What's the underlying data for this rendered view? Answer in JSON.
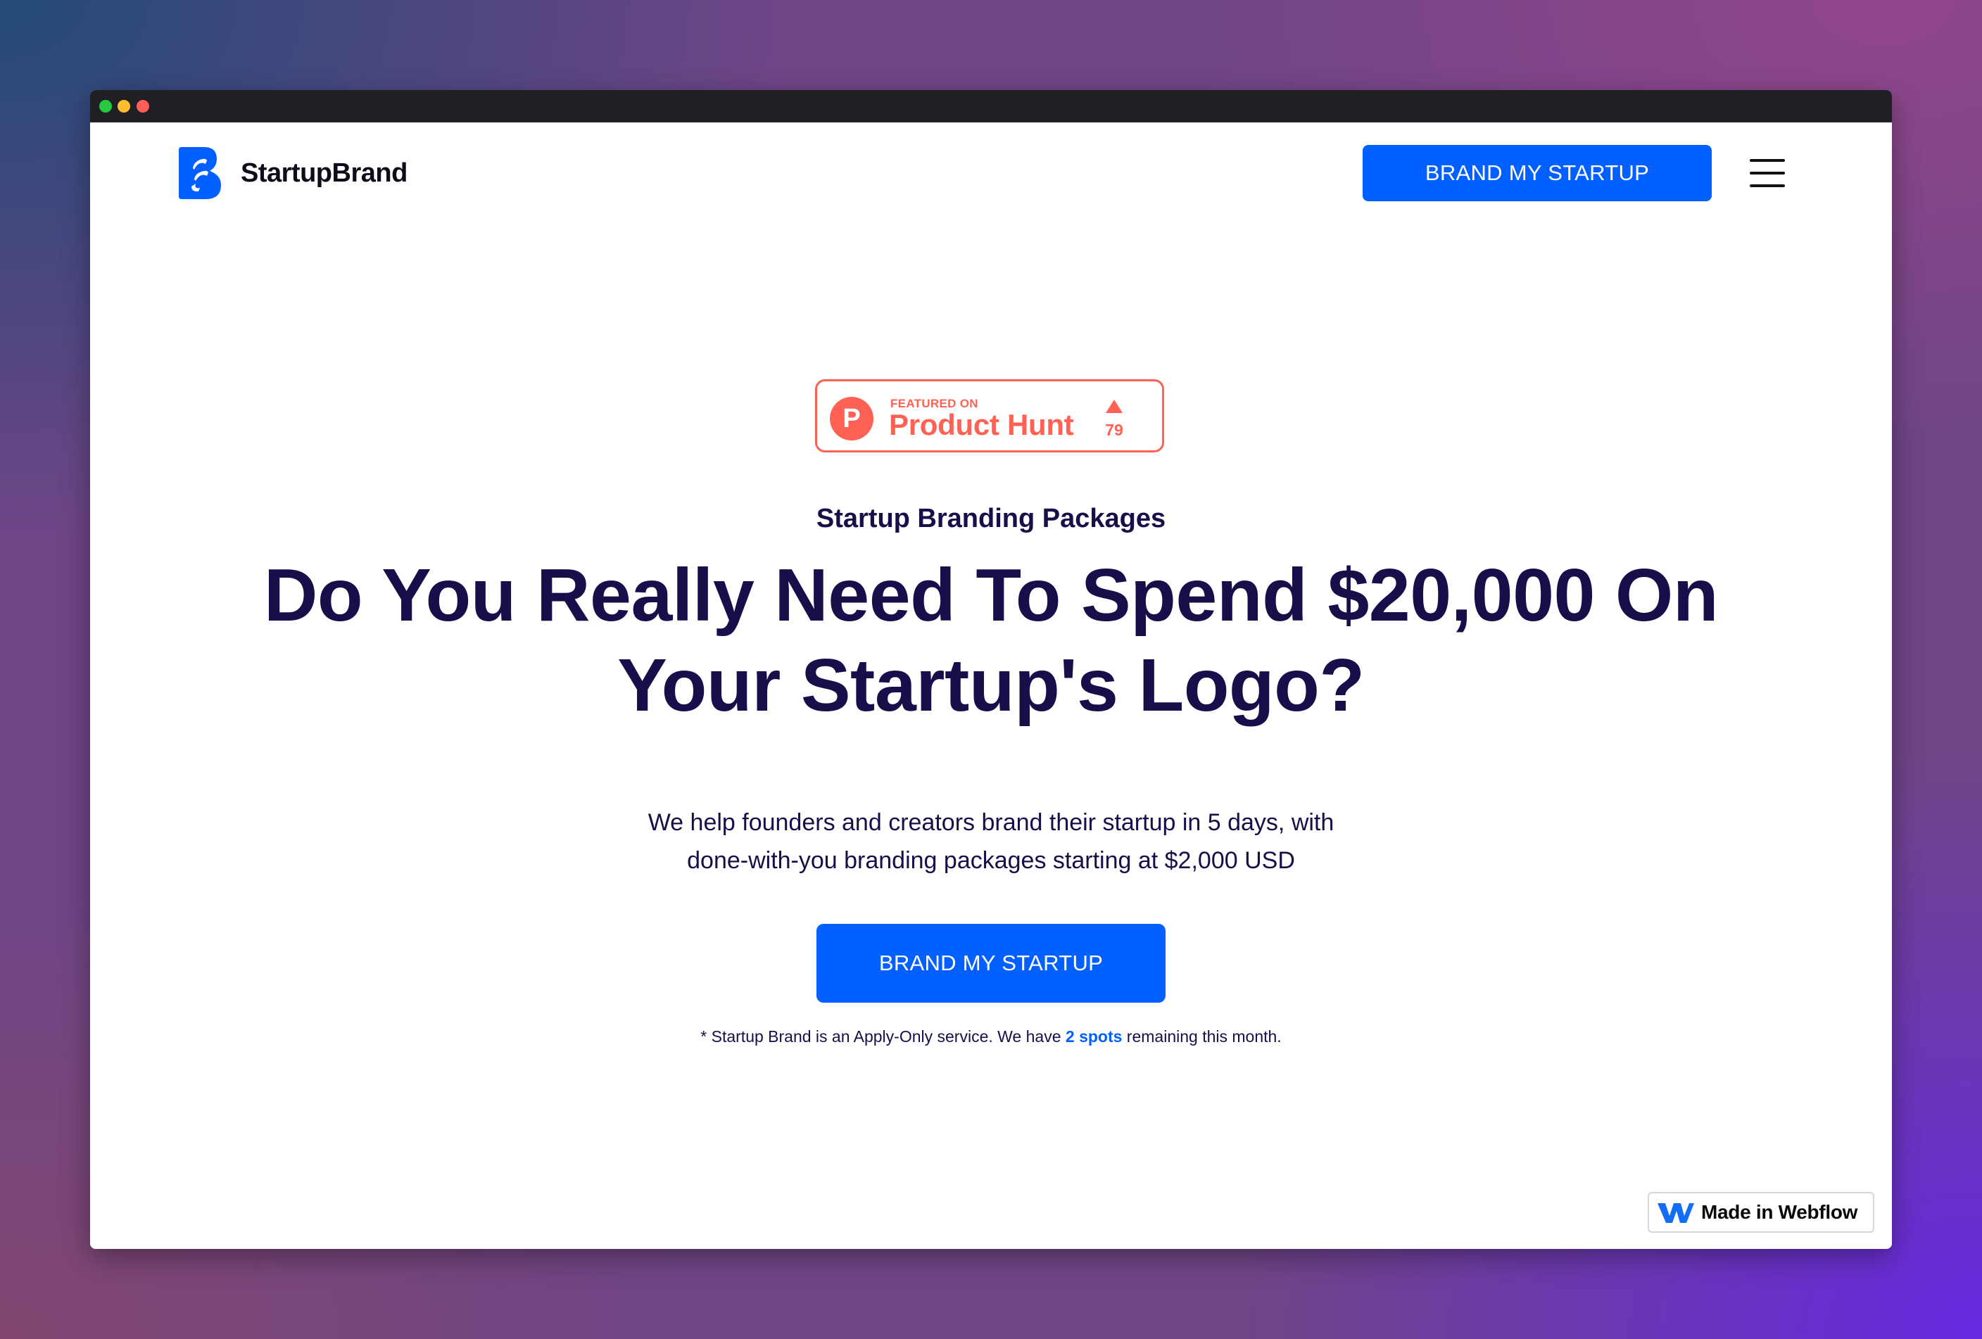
{
  "colors": {
    "primary_blue": "#0160ff",
    "heading_navy": "#170f4a",
    "product_hunt_orange": "#ff6154",
    "titlebar_dark": "#1f1f24"
  },
  "window": {
    "controls": [
      "close",
      "minimize",
      "maximize"
    ]
  },
  "nav": {
    "logo_icon": "startupbrand-logo-icon",
    "logo_text": "StartupBrand",
    "cta_label": "BRAND MY STARTUP",
    "menu_icon": "hamburger-menu-icon"
  },
  "product_hunt": {
    "featured_on": "FEATURED ON",
    "name": "Product Hunt",
    "logo_letter": "P",
    "upvote_icon": "upvote-arrow-icon",
    "upvotes": "79"
  },
  "hero": {
    "eyebrow": "Startup Branding Packages",
    "headline_line1": "Do You Really Need To Spend $20,000 On",
    "headline_line2": "Your Startup's Logo?",
    "subtext_line1": "We help founders and creators brand their startup in 5 days, with",
    "subtext_line2": "done-with-you branding packages starting at $2,000 USD",
    "cta_label": "BRAND MY STARTUP",
    "footnote_before": "* Startup Brand is an Apply-Only service. We have ",
    "footnote_highlight": "2 spots",
    "footnote_after": " remaining this month."
  },
  "webflow_badge": {
    "icon": "webflow-icon",
    "label": "Made in Webflow"
  }
}
